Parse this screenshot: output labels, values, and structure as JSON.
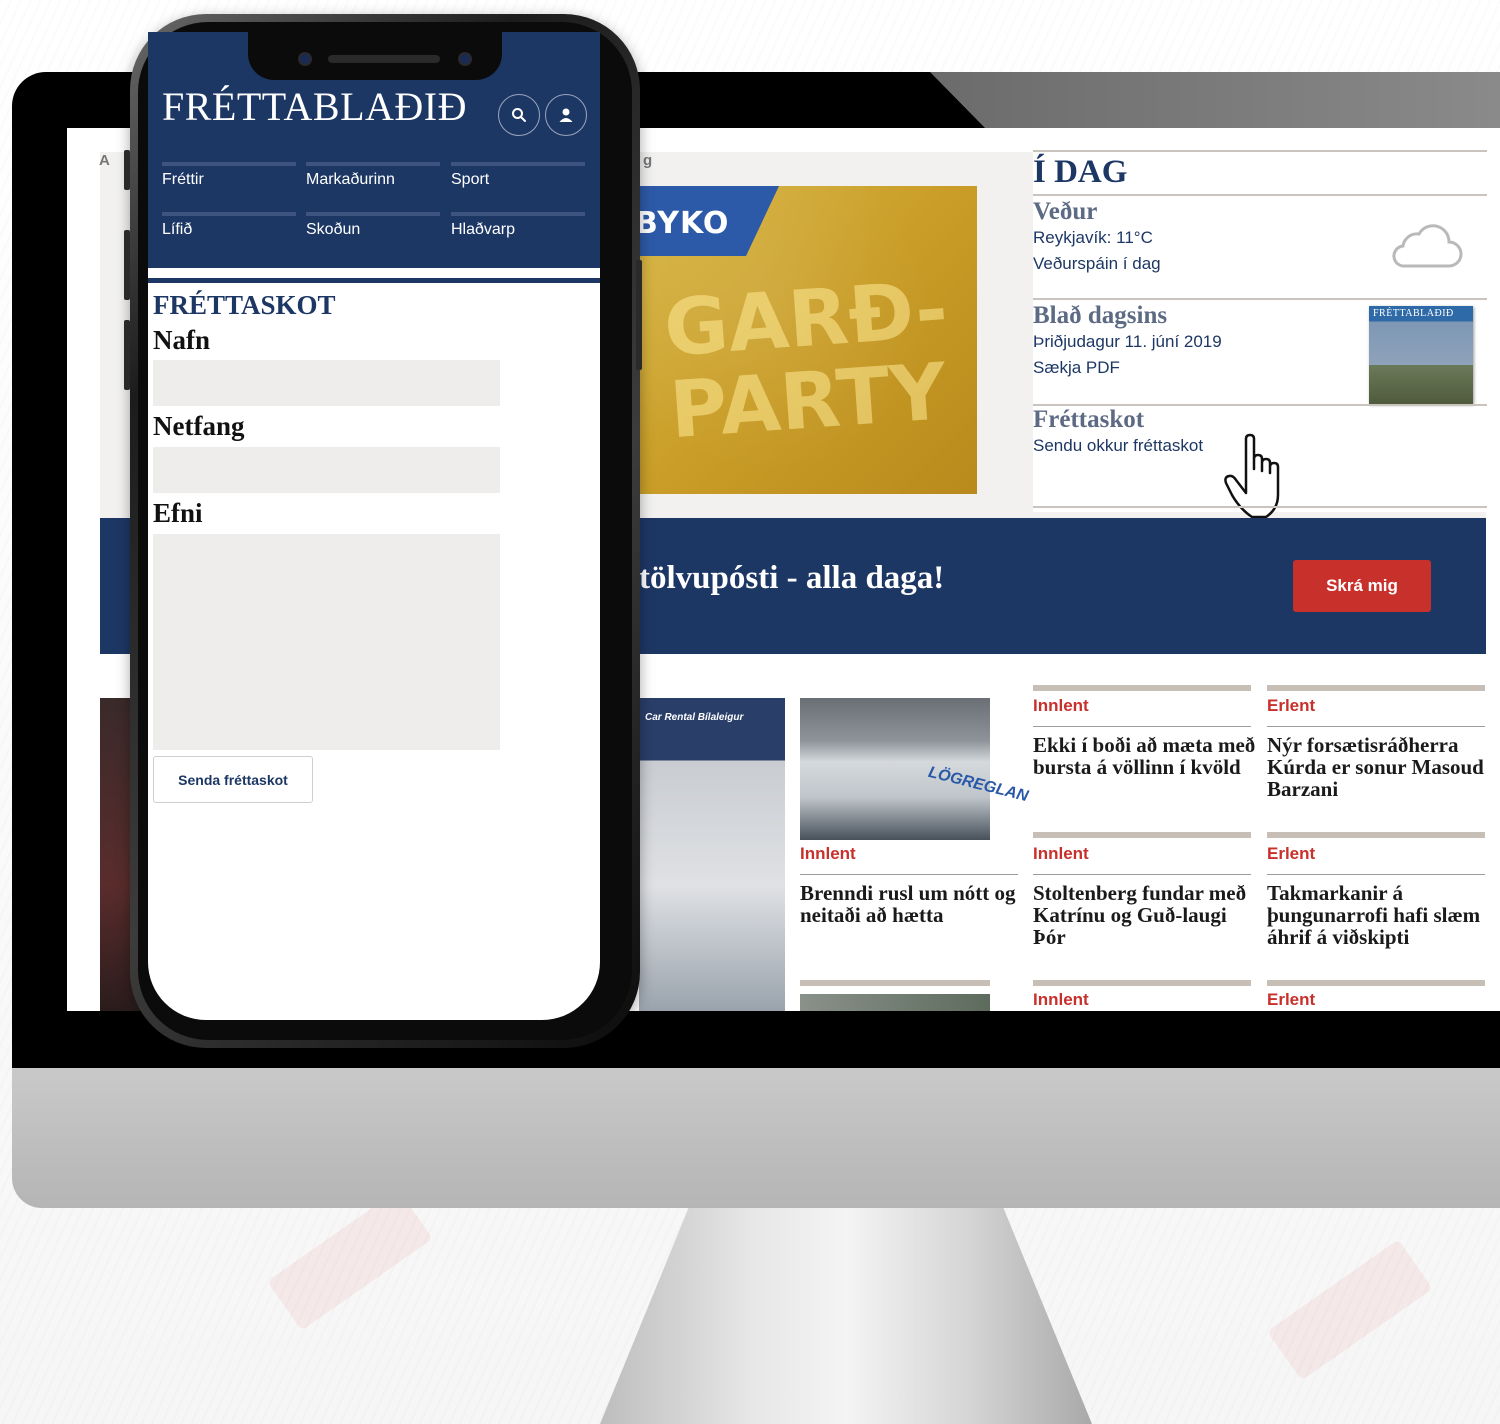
{
  "desktop": {
    "site_label_a": "A",
    "site_label_g": "g",
    "ad": {
      "logo": "BYKO",
      "tagline": "GARÐ-PARTY"
    },
    "today": {
      "title": "Í DAG",
      "weather": {
        "heading": "Veður",
        "line1": "Reykjavík: 11°C",
        "line2": "Veðurspáin í dag",
        "icon": "cloud-icon"
      },
      "paper": {
        "heading": "Blað dagsins",
        "line1": "Þriðjudagur 11. júní 2019",
        "line2": "Sækja PDF",
        "thumb_text": "FRÉTTABLAÐIÐ"
      },
      "tip": {
        "heading": "Fréttaskot",
        "line1": "Sendu okkur fréttaskot"
      }
    },
    "newsletter": {
      "text": "tölvupósti - alla daga!",
      "button": "Skrá mig"
    },
    "photos": {
      "carrental": "Car Rental Bílaleigur",
      "police": "LÖGREGLAN"
    },
    "articles": [
      {
        "category": "Innlent",
        "headline": "Ekki í boði að mæta með bursta á völlinn í kvöld"
      },
      {
        "category": "Erlent",
        "headline": "Nýr forsætisráðherra Kúrda er sonur Masoud Barzani"
      },
      {
        "category": "Innlent",
        "headline": "Brenndi rusl um nótt og neitaði að hætta"
      },
      {
        "category": "Innlent",
        "headline": "Stoltenberg fundar með Katrínu og Guð-laugi Þór"
      },
      {
        "category": "Erlent",
        "headline": "Takmarkanir á þungunarrofi hafi slæm áhrif á viðskipti"
      },
      {
        "category": "Innlent",
        "headline": ""
      },
      {
        "category": "Erlent",
        "headline": ""
      }
    ],
    "colors": {
      "navy": "#1d3765",
      "red": "#c8302c",
      "muted": "#5d6a84"
    }
  },
  "mobile": {
    "logo": "FRÉTTABLAÐIÐ",
    "search_icon": "search-icon",
    "user_icon": "user-icon",
    "nav": [
      "Fréttir",
      "Markaðurinn",
      "Sport",
      "Lífið",
      "Skoðun",
      "Hlaðvarp"
    ],
    "section_title": "FRÉTTASKOT",
    "form": {
      "name_label": "Nafn",
      "email_label": "Netfang",
      "subject_label": "Efni",
      "name_value": "",
      "email_value": "",
      "subject_value": "",
      "submit": "Senda fréttaskot"
    }
  }
}
